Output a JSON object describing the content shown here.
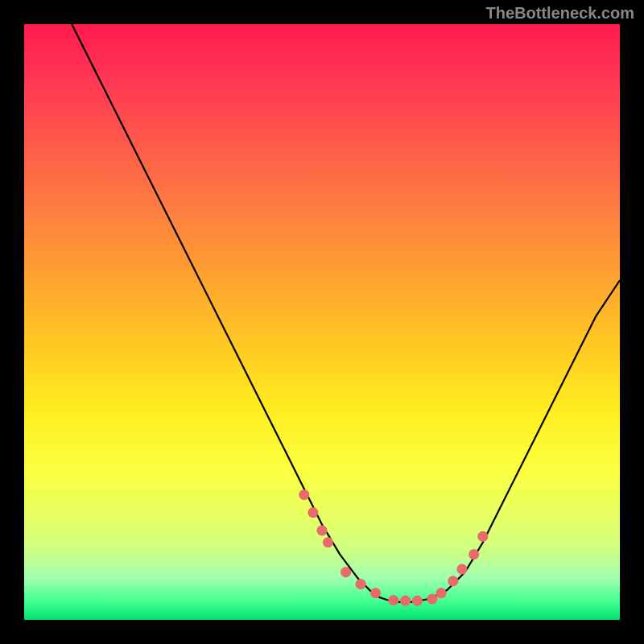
{
  "watermark": "TheBottleneck.com",
  "chart_data": {
    "type": "line",
    "title": "",
    "xlabel": "",
    "ylabel": "",
    "xlim": [
      0,
      100
    ],
    "ylim": [
      0,
      100
    ],
    "series": [
      {
        "name": "curve",
        "x": [
          8,
          12,
          16,
          20,
          24,
          28,
          32,
          36,
          40,
          44,
          47,
          50,
          53,
          56,
          59,
          62,
          65,
          68,
          71,
          74,
          77,
          80,
          84,
          88,
          92,
          96,
          100
        ],
        "y": [
          100,
          92,
          84,
          76,
          68,
          60,
          52,
          44,
          36,
          28,
          22,
          16,
          11,
          7,
          4,
          3,
          3,
          3.5,
          5,
          8,
          13,
          19,
          27,
          35,
          43,
          51,
          57
        ]
      }
    ],
    "markers": {
      "name": "dots",
      "x": [
        47,
        48.5,
        50,
        51,
        54,
        56.5,
        59,
        62,
        64,
        66,
        68.5,
        70,
        72,
        73.5,
        75.5,
        77
      ],
      "y": [
        21,
        18,
        15,
        13,
        8,
        6,
        4.5,
        3.3,
        3.2,
        3.2,
        3.5,
        4.5,
        6.5,
        8.5,
        11,
        14
      ]
    },
    "gradient_stops": [
      {
        "pos": 0,
        "color": "#ff1a4d"
      },
      {
        "pos": 20,
        "color": "#ff5a4a"
      },
      {
        "pos": 42,
        "color": "#ffa030"
      },
      {
        "pos": 65,
        "color": "#ffee20"
      },
      {
        "pos": 88,
        "color": "#d0ff80"
      },
      {
        "pos": 100,
        "color": "#00e070"
      }
    ],
    "marker_color": "#e86a6a",
    "curve_color": "#000000"
  }
}
